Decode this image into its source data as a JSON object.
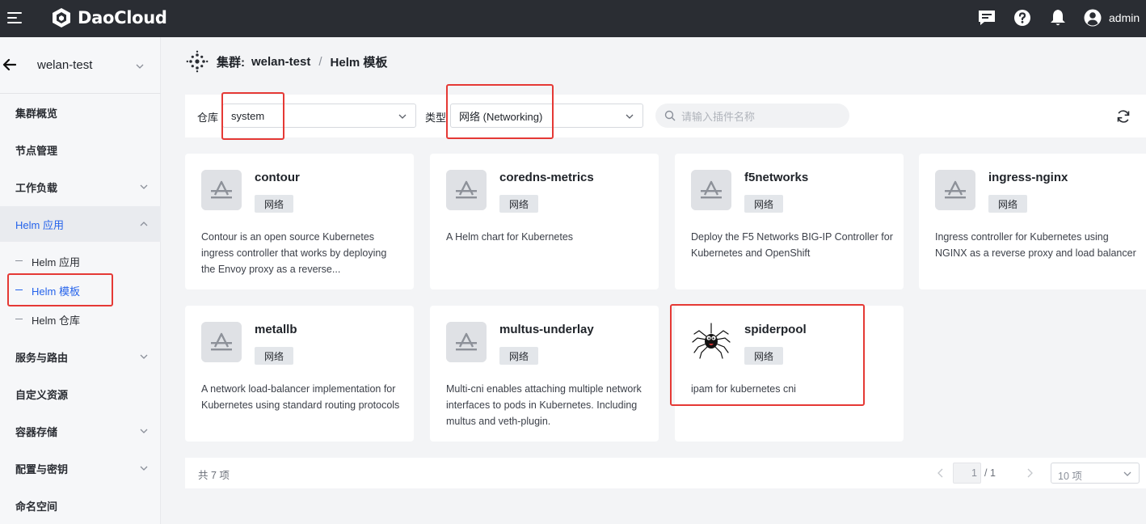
{
  "topbar": {
    "brand": "DaoCloud",
    "user": "admin",
    "icons": [
      "menu-icon",
      "message-icon",
      "help-icon",
      "bell-icon",
      "user-icon"
    ]
  },
  "sidebar": {
    "cluster": "welan-test",
    "items": [
      {
        "label": "集群概览"
      },
      {
        "label": "节点管理"
      },
      {
        "label": "工作负载"
      },
      {
        "label": "Helm 应用"
      },
      {
        "label": "服务与路由"
      },
      {
        "label": "自定义资源"
      },
      {
        "label": "容器存储"
      },
      {
        "label": "配置与密钥"
      },
      {
        "label": "命名空间"
      }
    ],
    "helm_sub": [
      {
        "label": "Helm 应用"
      },
      {
        "label": "Helm 模板"
      },
      {
        "label": "Helm 仓库"
      }
    ]
  },
  "breadcrumb": {
    "cluster_label": "集群:",
    "cluster": "welan-test",
    "sep": "/",
    "page": "Helm 模板"
  },
  "filters": {
    "repo_label": "仓库",
    "repo_value": "system",
    "type_label": "类型",
    "type_value": "网络 (Networking)",
    "search_placeholder": "请输入插件名称"
  },
  "cards": [
    {
      "title": "contour",
      "tag": "网络",
      "desc": "Contour is an open source Kubernetes ingress controller that works by deploying the Envoy proxy as a reverse..."
    },
    {
      "title": "coredns-metrics",
      "tag": "网络",
      "desc": "A Helm chart for Kubernetes"
    },
    {
      "title": "f5networks",
      "tag": "网络",
      "desc": "Deploy the F5 Networks BIG-IP Controller for Kubernetes and OpenShift"
    },
    {
      "title": "ingress-nginx",
      "tag": "网络",
      "desc": "Ingress controller for Kubernetes using NGINX as a reverse proxy and load balancer"
    },
    {
      "title": "metallb",
      "tag": "网络",
      "desc": "A network load-balancer implementation for Kubernetes using standard routing protocols"
    },
    {
      "title": "multus-underlay",
      "tag": "网络",
      "desc": "Multi-cni enables attaching multiple network interfaces to pods in Kubernetes. Including multus and veth-plugin."
    },
    {
      "title": "spiderpool",
      "tag": "网络",
      "desc": "ipam for kubernetes cni"
    }
  ],
  "pagination": {
    "total": "共 7 项",
    "current": "1",
    "pages": "/ 1",
    "page_size": "10 项"
  },
  "colors": {
    "topbar": "#2a2d33",
    "accent": "#2563eb",
    "highlight": "#e53935"
  }
}
